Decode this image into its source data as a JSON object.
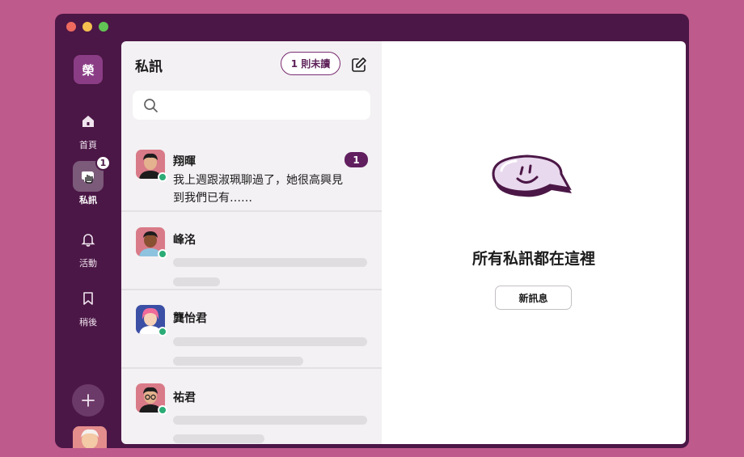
{
  "workspace": {
    "initial": "榮"
  },
  "rail": {
    "items": [
      {
        "label": "首頁",
        "icon": "home-icon"
      },
      {
        "label": "私訊",
        "icon": "dm-icon",
        "badge": "1",
        "active": true
      },
      {
        "label": "活動",
        "icon": "bell-icon"
      },
      {
        "label": "稍後",
        "icon": "bookmark-icon"
      }
    ]
  },
  "dm_panel": {
    "title": "私訊",
    "unread_label": "1 則未讀",
    "search_placeholder": "",
    "conversations": [
      {
        "name": "翔暉",
        "preview": "我上週跟淑珮聊過了，她很高興見到我們已有……",
        "unread": "1"
      },
      {
        "name": "峰洺"
      },
      {
        "name": "龔怡君"
      },
      {
        "name": "祐君"
      }
    ]
  },
  "main": {
    "empty_title": "所有私訊都在這裡",
    "new_message_label": "新訊息"
  },
  "colors": {
    "background": "#bf5a8c",
    "window": "#4b1746",
    "accent": "#611f5f",
    "presence": "#2bac76"
  }
}
